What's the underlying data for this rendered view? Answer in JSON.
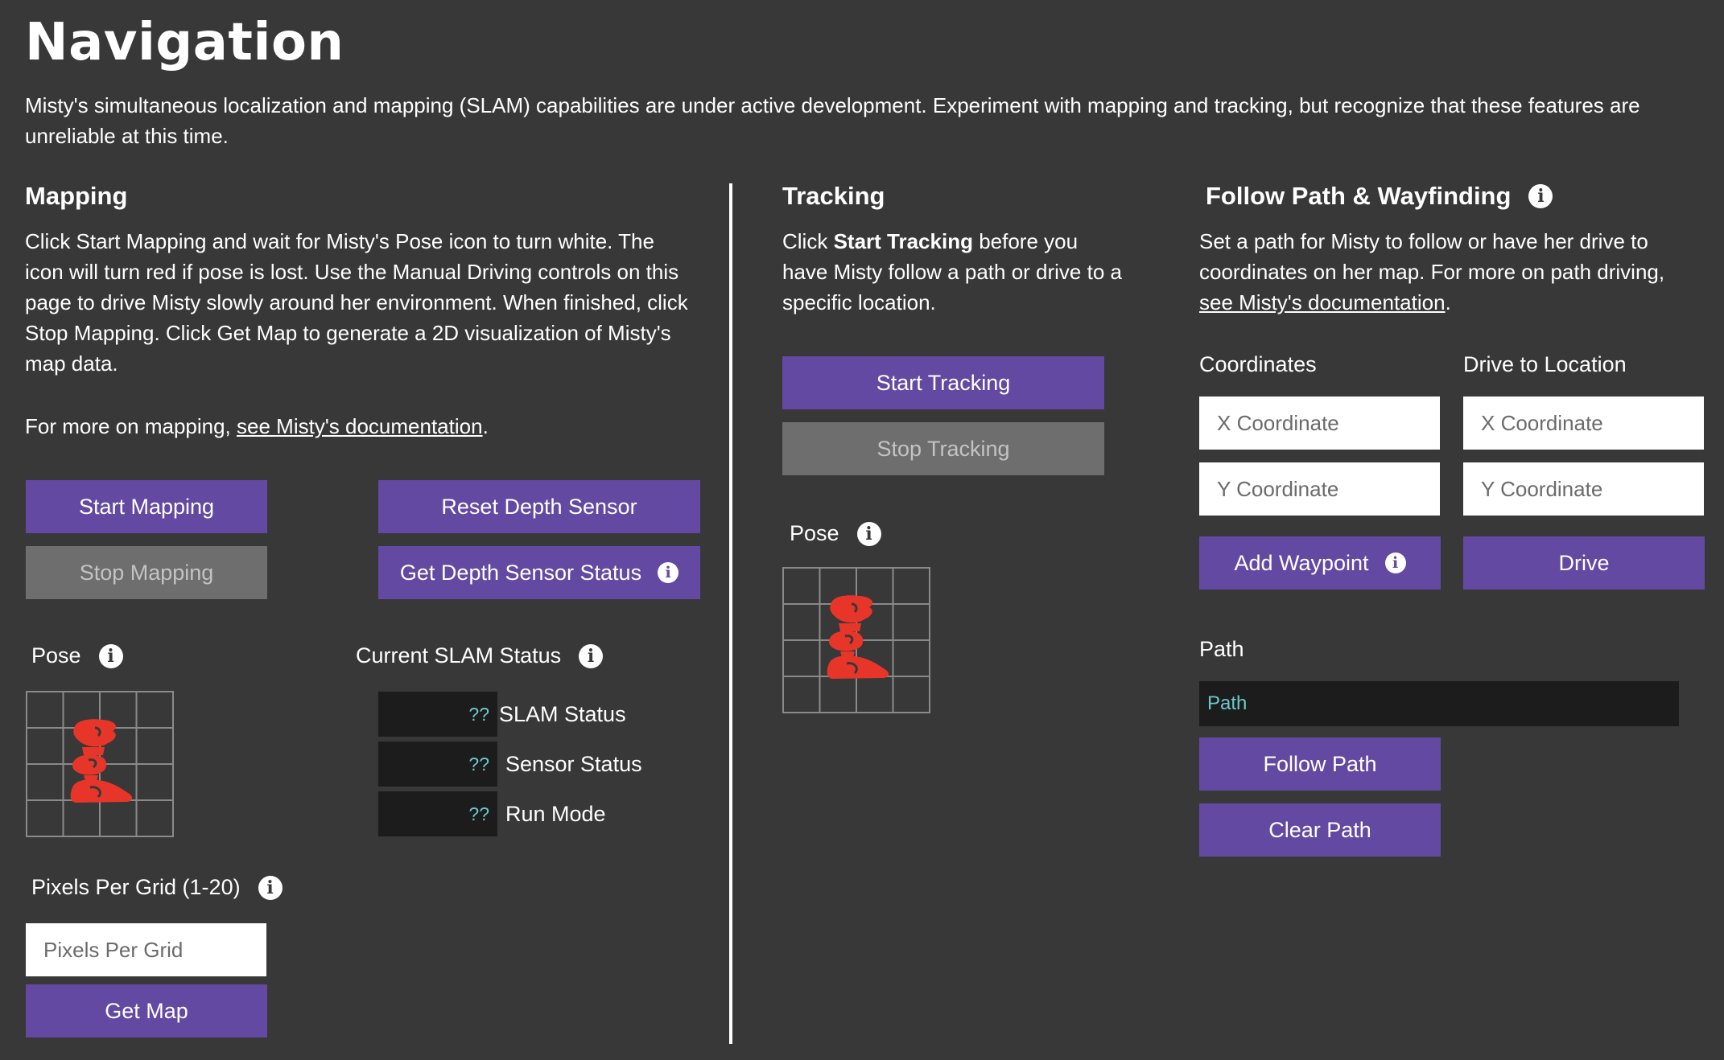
{
  "page": {
    "title": "Navigation",
    "intro": "Misty's simultaneous localization and mapping (SLAM) capabilities are under active development. Experiment with mapping and tracking, but recognize that these features are unreliable at this time."
  },
  "icons": {
    "info": "info-circle-icon",
    "pose": "misty-robot-pose-icon"
  },
  "colors": {
    "background": "#383838",
    "accent": "#6349a1",
    "disabled": "#6e6e6e",
    "pose_icon": "#e8352a",
    "status_value": "#6ec9c9"
  },
  "mapping": {
    "heading": "Mapping",
    "description": "Click Start Mapping and wait for Misty's Pose icon to turn white. The icon will turn red if pose is lost. Use the Manual Driving controls on this page to drive Misty slowly around her environment. When finished, click Stop Mapping. Click Get Map to generate a 2D visualization of Misty's map data.",
    "more_prefix": "For more on mapping, ",
    "more_link": "see Misty's documentation",
    "more_suffix": ".",
    "start_label": "Start Mapping",
    "stop_label": "Stop Mapping",
    "reset_label": "Reset Depth Sensor",
    "depth_status_label": "Get Depth Sensor Status",
    "pose_label": "Pose",
    "slam_status_heading": "Current SLAM Status",
    "status_rows": [
      {
        "value": "??",
        "label": "SLAM Status"
      },
      {
        "value": "??",
        "label": "Sensor Status"
      },
      {
        "value": "??",
        "label": "Run Mode"
      }
    ],
    "pixels_label": "Pixels Per Grid (1-20)",
    "pixels_placeholder": "Pixels Per Grid",
    "get_map_label": "Get Map"
  },
  "tracking": {
    "heading": "Tracking",
    "desc_prefix": "Click ",
    "desc_bold": "Start Tracking",
    "desc_suffix": " before you have Misty follow a path or drive to a specific location.",
    "start_label": "Start Tracking",
    "stop_label": "Stop Tracking",
    "pose_label": "Pose"
  },
  "follow": {
    "heading": "Follow Path & Wayfinding",
    "description": "Set a path for Misty to follow or have her drive to coordinates on her map. For more on path driving, ",
    "link": "see Misty's documentation",
    "suffix": ".",
    "coordinates_label": "Coordinates",
    "drive_label": "Drive to Location",
    "x_placeholder": "X Coordinate",
    "y_placeholder": "Y Coordinate",
    "add_waypoint_label": "Add Waypoint",
    "drive_button": "Drive",
    "path_label": "Path",
    "path_placeholder": "Path",
    "follow_path_label": "Follow Path",
    "clear_path_label": "Clear Path"
  }
}
